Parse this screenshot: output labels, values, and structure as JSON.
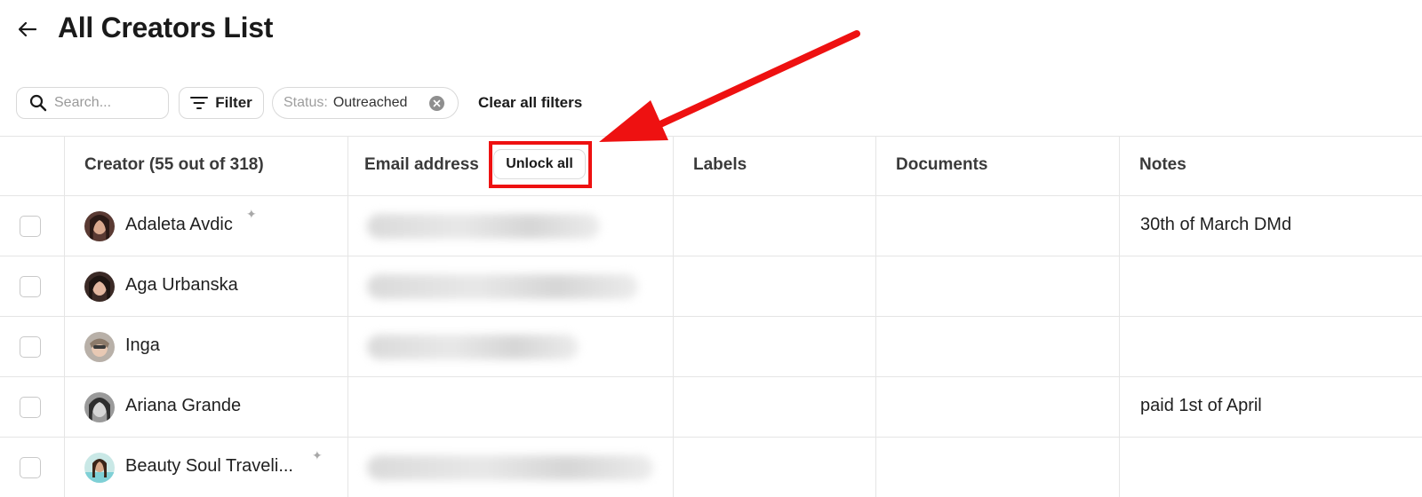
{
  "header": {
    "title": "All Creators List",
    "back_icon": "arrow-left-icon"
  },
  "toolbar": {
    "search_placeholder": "Search...",
    "filter_label": "Filter",
    "status_chip": {
      "key": "Status:",
      "value": "Outreached"
    },
    "clear_filters_label": "Clear all filters"
  },
  "table": {
    "columns": {
      "creator": "Creator (55 out of 318)",
      "email": "Email address",
      "labels": "Labels",
      "documents": "Documents",
      "notes": "Notes"
    },
    "unlock_all_label": "Unlock all",
    "rows": [
      {
        "name": "Adaleta Avdic",
        "sparkle": true,
        "email_hidden": true,
        "note": "30th of March DMd"
      },
      {
        "name": "Aga Urbanska",
        "sparkle": false,
        "email_hidden": true,
        "note": ""
      },
      {
        "name": "Inga",
        "sparkle": false,
        "email_hidden": true,
        "note": ""
      },
      {
        "name": "Ariana Grande",
        "sparkle": false,
        "email_hidden": false,
        "note": "paid 1st of April"
      },
      {
        "name": "Beauty Soul Traveli...",
        "sparkle": true,
        "email_hidden": true,
        "note": ""
      }
    ]
  },
  "colors": {
    "annotation_red": "#ee1111",
    "border": "#e5e5e5",
    "text": "#1f1f1f"
  }
}
